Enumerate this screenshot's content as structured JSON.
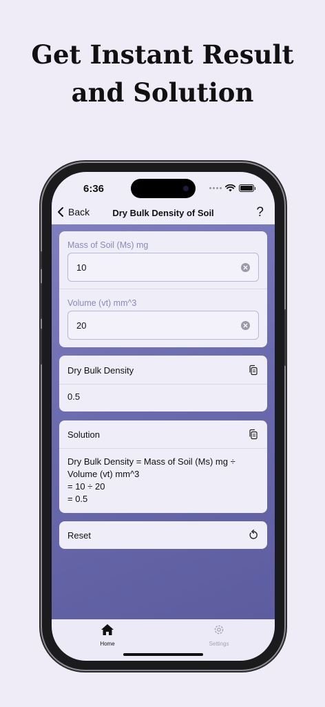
{
  "headline": {
    "line1": "Get Instant Result",
    "line2": "and Solution"
  },
  "status_bar": {
    "time": "6:36"
  },
  "nav": {
    "back_label": "Back",
    "title": "Dry Bulk Density of Soil",
    "help_label": "?"
  },
  "inputs": {
    "mass_label": "Mass of Soil (Ms) mg",
    "mass_value": "10",
    "volume_label": "Volume (vt) mm^3",
    "volume_value": "20"
  },
  "result": {
    "title": "Dry Bulk Density",
    "value": "0.5"
  },
  "solution": {
    "title": "Solution",
    "line1": "Dry Bulk Density = Mass of Soil (Ms) mg ÷",
    "line2": "Volume (vt) mm^3",
    "line3": "= 10 ÷ 20",
    "line4": "= 0.5"
  },
  "reset": {
    "label": "Reset"
  },
  "tabs": [
    {
      "label": "Home",
      "icon": "house-icon",
      "active": true
    },
    {
      "label": "Settings",
      "icon": "gear-icon",
      "active": false
    }
  ],
  "colors": {
    "background": "#efecf8",
    "content_gradient_top": "#7f7fc0",
    "content_gradient_bottom": "#5c5c9f",
    "card": "#eeedf8",
    "field_label": "#8a89b8"
  }
}
